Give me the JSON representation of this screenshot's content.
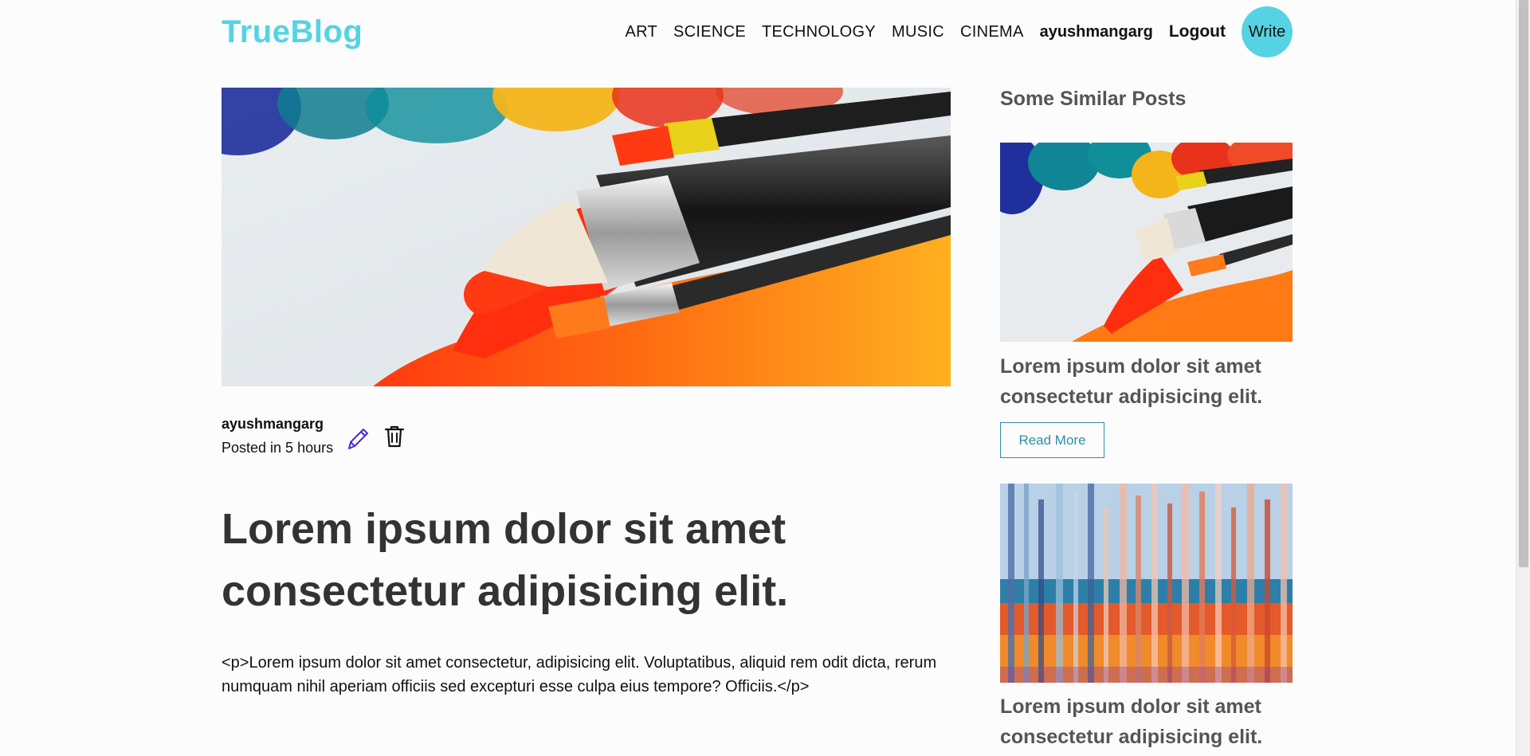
{
  "navbar": {
    "logo": "TrueBlog",
    "links": [
      "ART",
      "SCIENCE",
      "TECHNOLOGY",
      "MUSIC",
      "CINEMA"
    ],
    "username": "ayushmangarg",
    "logout_label": "Logout",
    "write_label": "Write"
  },
  "post": {
    "author": "ayushmangarg",
    "posted": "Posted in 5 hours",
    "title": "Lorem ipsum dolor sit amet consectetur adipisicing elit.",
    "body": "<p>Lorem ipsum dolor sit amet consectetur, adipisicing elit. Voluptatibus, aliquid rem odit dicta, rerum numquam nihil aperiam officiis sed excepturi esse culpa eius tempore? Officiis.</p>",
    "edit_icon": "pencil-icon",
    "delete_icon": "trash-icon"
  },
  "sidebar": {
    "title": "Some Similar Posts",
    "posts": [
      {
        "title": "Lorem ipsum dolor sit amet consectetur adipisicing elit.",
        "read_more": "Read More"
      },
      {
        "title": "Lorem ipsum dolor sit amet consectetur adipisicing elit."
      }
    ]
  },
  "colors": {
    "brand": "#55d3e2",
    "read_more": "#2d8fa8",
    "edit_icon": "#4b2ad6",
    "heading": "#333333",
    "sidebar_text": "#555555"
  }
}
